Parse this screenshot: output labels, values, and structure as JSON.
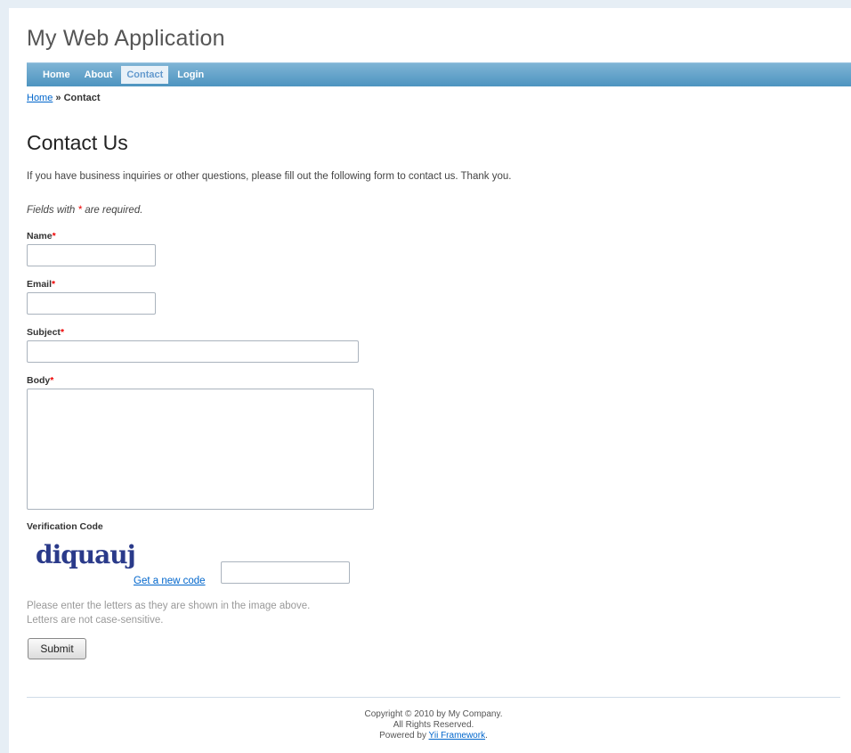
{
  "app": {
    "title": "My Web Application"
  },
  "menu": {
    "items": [
      {
        "label": "Home",
        "active": false
      },
      {
        "label": "About",
        "active": false
      },
      {
        "label": "Contact",
        "active": true
      },
      {
        "label": "Login",
        "active": false
      }
    ]
  },
  "breadcrumb": {
    "home": "Home",
    "separator": " » ",
    "current": "Contact"
  },
  "page": {
    "heading": "Contact Us",
    "intro": "If you have business inquiries or other questions, please fill out the following form to contact us. Thank you.",
    "note_prefix": "Fields with ",
    "note_star": "*",
    "note_suffix": " are required."
  },
  "form": {
    "name_label": "Name",
    "name_value": "",
    "email_label": "Email",
    "email_value": "",
    "subject_label": "Subject",
    "subject_value": "",
    "body_label": "Body",
    "body_value": "",
    "required_mark": "*",
    "verification_label": "Verification Code",
    "captcha_text": "diquauj",
    "new_code_link": "Get a new code",
    "verify_value": "",
    "hint_line1": "Please enter the letters as they are shown in the image above.",
    "hint_line2": "Letters are not case-sensitive.",
    "submit_label": "Submit"
  },
  "footer": {
    "line1": "Copyright © 2010 by My Company.",
    "line2": "All Rights Reserved.",
    "powered_prefix": "Powered by ",
    "powered_link": "Yii Framework",
    "powered_suffix": "."
  },
  "colors": {
    "menu_bar": "#4d94c0",
    "link": "#0066cc",
    "required": "#ee0000"
  }
}
